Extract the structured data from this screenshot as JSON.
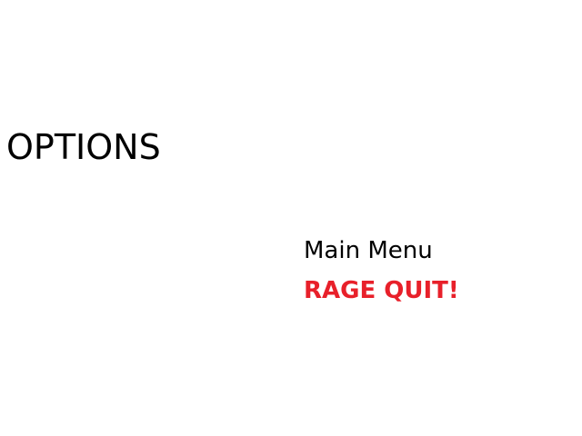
{
  "screen": {
    "title": "OPTIONS"
  },
  "menu": {
    "items": [
      {
        "label": "Main Menu"
      },
      {
        "label": "RAGE QUIT!"
      }
    ]
  },
  "colors": {
    "text": "#000000",
    "quit": "#e8202a",
    "background": "#ffffff"
  }
}
